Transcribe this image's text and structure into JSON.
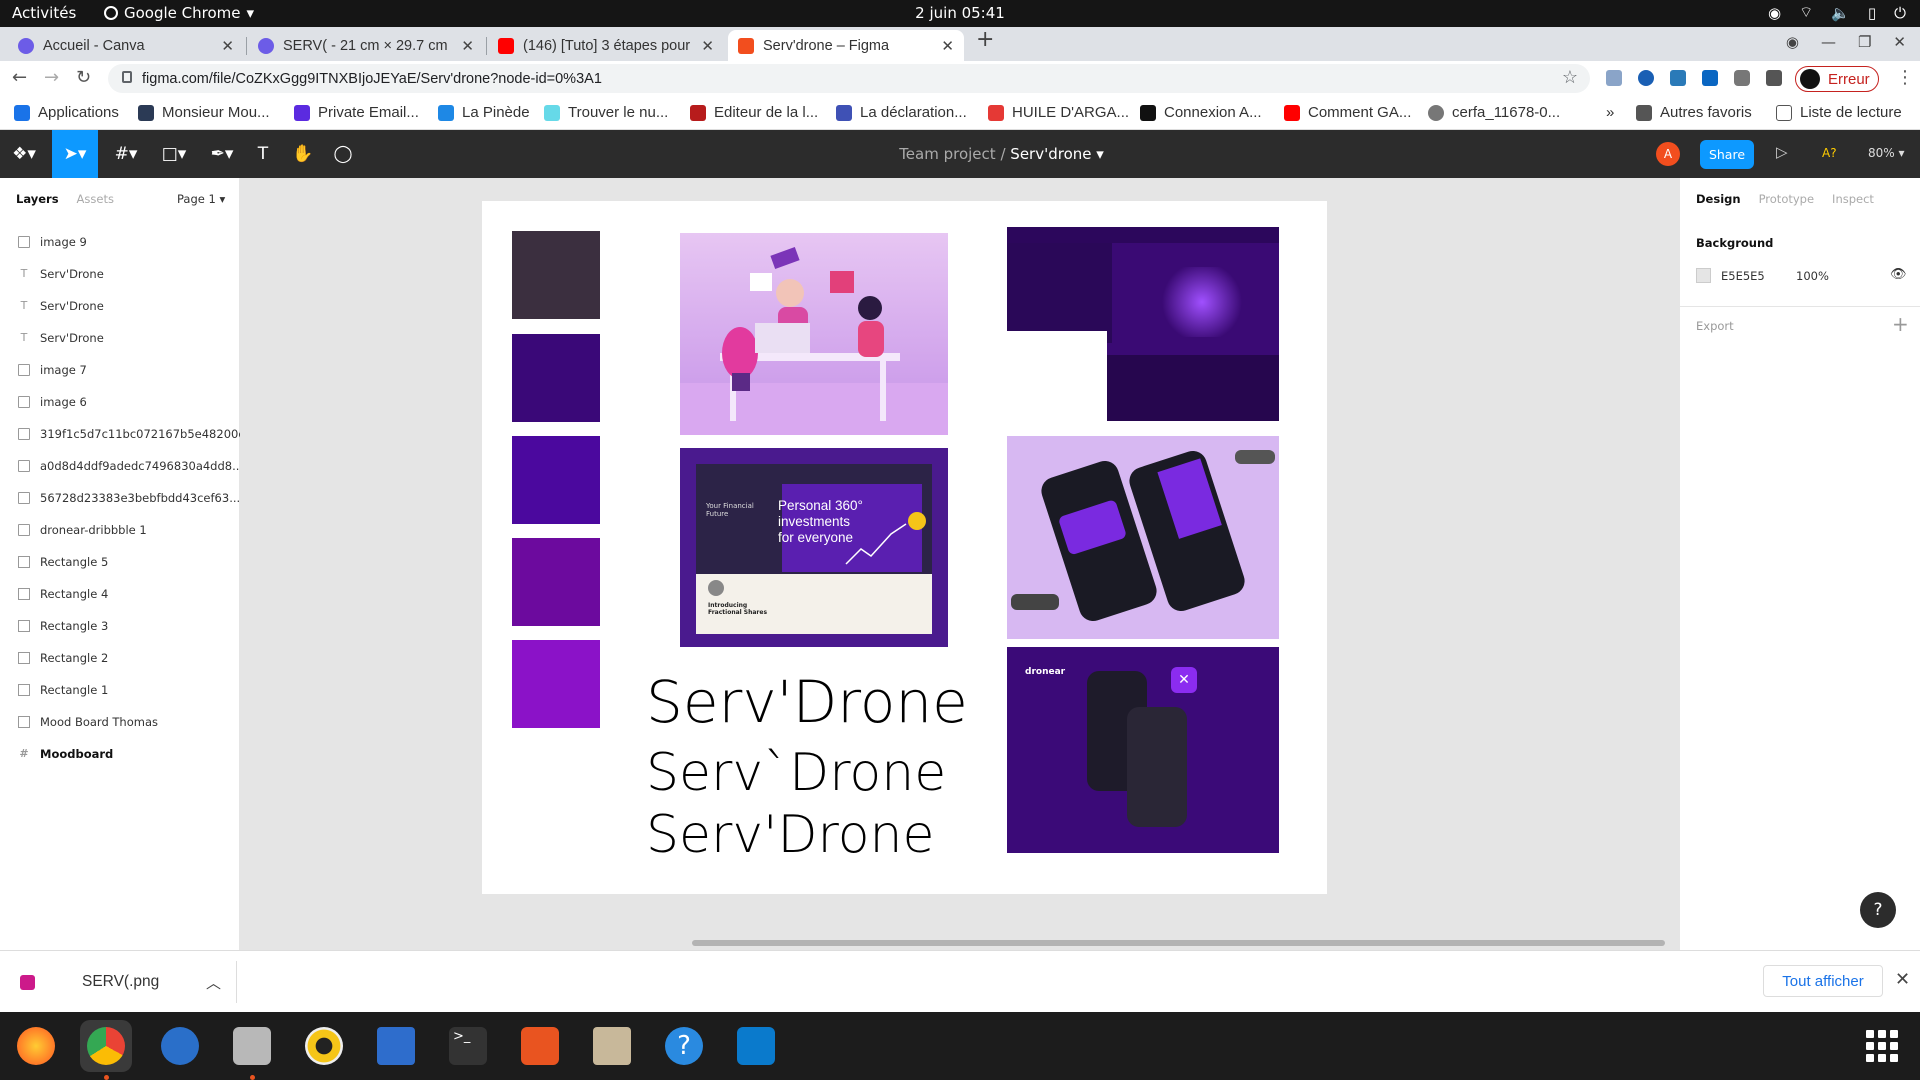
{
  "os_bar": {
    "activities": "Activités",
    "app_name": "Google Chrome",
    "clock": "2 juin  05:41"
  },
  "tabs": [
    {
      "title": "Accueil - Canva",
      "favicon_color": "#6c5ce7"
    },
    {
      "title": "SERV( - 21 cm × 29.7 cm",
      "favicon_color": "#6c5ce7"
    },
    {
      "title": "(146) [Tuto] 3 étapes pour",
      "favicon_color": "#ff0000"
    },
    {
      "title": "Serv'drone – Figma",
      "favicon_color": "#f24e1e"
    }
  ],
  "address_bar": {
    "url": "figma.com/file/CoZKxGgg9ITNXBIjoJEYaE/Serv'drone?node-id=0%3A1",
    "profile_button": "Erreur"
  },
  "bookmarks": [
    {
      "label": "Applications",
      "color": "#1a73e8"
    },
    {
      "label": "Monsieur Mou...",
      "color": "#2b3a55"
    },
    {
      "label": "Private Email...",
      "color": "#5b2be0"
    },
    {
      "label": "La Pinède",
      "color": "#1e88e5"
    },
    {
      "label": "Trouver le nu...",
      "color": "#66d9e8"
    },
    {
      "label": "Editeur de la l...",
      "color": "#b71c1c"
    },
    {
      "label": "La déclaration...",
      "color": "#3f51b5"
    },
    {
      "label": "HUILE D'ARGA...",
      "color": "#e53935"
    },
    {
      "label": "Connexion A...",
      "color": "#111111"
    },
    {
      "label": "Comment GA...",
      "color": "#ff0000"
    },
    {
      "label": "cerfa_11678-0...",
      "color": "#777777"
    }
  ],
  "bookmarks_more": "»",
  "other_bookmarks": "Autres favoris",
  "reading_list": "Liste de lecture",
  "figma": {
    "project": "Team project",
    "separator": "/",
    "file_name": "Serv'drone",
    "avatar_letter": "A",
    "share_label": "Share",
    "aq_label": "A?",
    "zoom_label": "80%"
  },
  "layers_panel": {
    "tab_layers": "Layers",
    "tab_assets": "Assets",
    "page": "Page 1",
    "items": [
      {
        "name": "image 9",
        "kind": "image"
      },
      {
        "name": "Serv'Drone",
        "kind": "text"
      },
      {
        "name": "Serv'Drone",
        "kind": "text"
      },
      {
        "name": "Serv'Drone",
        "kind": "text"
      },
      {
        "name": "image 7",
        "kind": "image"
      },
      {
        "name": "image 6",
        "kind": "image"
      },
      {
        "name": "319f1c5d7c11bc072167b5e48200c...",
        "kind": "image"
      },
      {
        "name": "a0d8d4ddf9adedc7496830a4dd8...",
        "kind": "image"
      },
      {
        "name": "56728d23383e3bebfbdd43cef63...",
        "kind": "image"
      },
      {
        "name": "dronear-dribbble 1",
        "kind": "image"
      },
      {
        "name": "Rectangle 5",
        "kind": "rect"
      },
      {
        "name": "Rectangle 4",
        "kind": "rect"
      },
      {
        "name": "Rectangle 3",
        "kind": "rect"
      },
      {
        "name": "Rectangle 2",
        "kind": "rect"
      },
      {
        "name": "Rectangle 1",
        "kind": "rect"
      },
      {
        "name": "Mood Board Thomas",
        "kind": "rect"
      },
      {
        "name": "Moodboard",
        "kind": "frame"
      }
    ]
  },
  "design_panel": {
    "tab_design": "Design",
    "tab_prototype": "Prototype",
    "tab_inspect": "Inspect",
    "background_title": "Background",
    "background_hex": "E5E5E5",
    "background_opacity": "100%",
    "export_label": "Export"
  },
  "moodboard": {
    "swatches": [
      "#3b2f3f",
      "#3a0878",
      "#4b089e",
      "#6c0a9e",
      "#8b12c8"
    ],
    "title_lines": [
      "Serv'Drone",
      "Serv`Drone",
      "Serv'Drone"
    ],
    "finance_card": {
      "side_title": "Your Financial Future",
      "headline_line1": "Personal 360°",
      "headline_line2": "investments",
      "headline_line3": "for everyone",
      "feature1": "Introducing Fractional Shares"
    },
    "dronear_label": "dronear"
  },
  "download_bar": {
    "file": "SERV(.png",
    "show_all": "Tout afficher"
  },
  "help_label": "?"
}
